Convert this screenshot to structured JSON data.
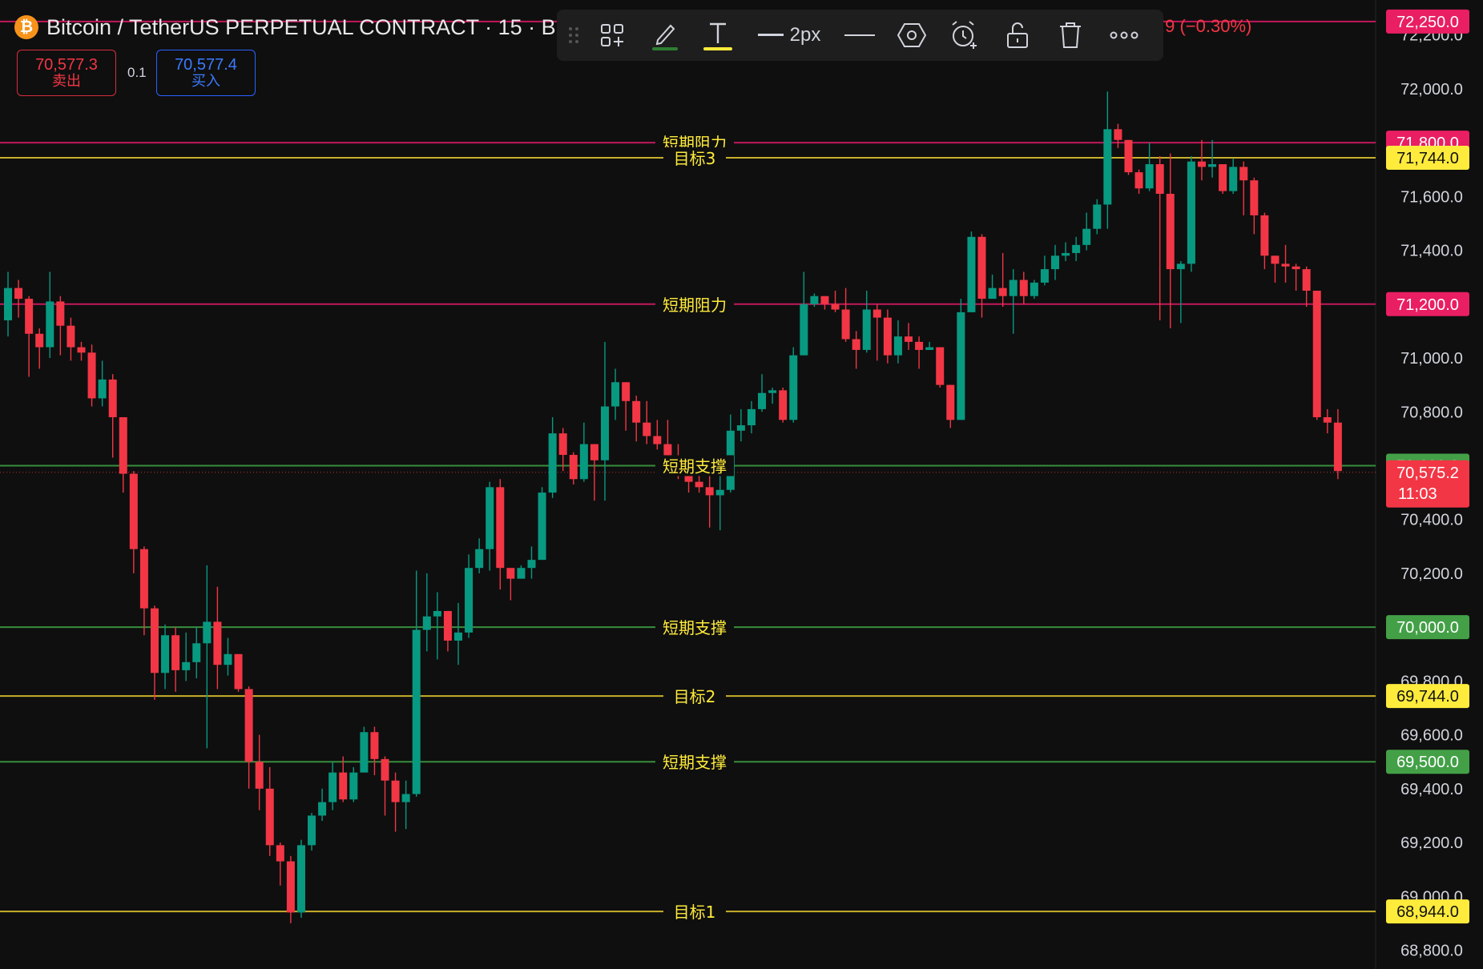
{
  "header": {
    "coin_glyph": "₿",
    "title": "Bitcoin / TetherUS PERPETUAL CONTRACT · 15 · Bin",
    "change_text": ".9 (−0.30%)"
  },
  "trade": {
    "sell_price": "70,577.3",
    "sell_label": "卖出",
    "spread": "0.1",
    "buy_price": "70,577.4",
    "buy_label": "买入"
  },
  "toolbar": {
    "icons": [
      "drag-handle-icon",
      "template-icon",
      "pencil-icon",
      "text-icon",
      "line-width-icon",
      "line-style-icon",
      "hexagon-settings-icon",
      "alert-icon",
      "unlock-icon",
      "trash-icon",
      "more-icon"
    ],
    "line_width_label": "2px",
    "pencil_color": "#2e7d32",
    "text_color": "#ffeb3b"
  },
  "colors": {
    "background": "#0f0f0f",
    "up": "#089981",
    "down": "#f23645",
    "resistance": "#c2185b",
    "support": "#388e3c",
    "target": "#c8b02a",
    "resistance_tag": "#e91e63",
    "support_tag": "#43a047",
    "target_tag": "#ffeb3b",
    "axis_text": "#d1d4dc"
  },
  "chart_data": {
    "type": "candlestick",
    "interval": "15",
    "y_axis_ticks": [
      "72,200.0",
      "72,000.0",
      "71,600.0",
      "71,400.0",
      "71,000.0",
      "70,800.0",
      "70,400.0",
      "70,200.0",
      "69,800.0",
      "69,600.0",
      "69,400.0",
      "69,200.0",
      "69,000.0",
      "68,800.0"
    ],
    "ylim": [
      68730,
      72330
    ],
    "current_price": {
      "value": 70575.2,
      "label": "70,575.2",
      "countdown": "11:03"
    },
    "horizontal_lines": [
      {
        "kind": "resistance",
        "value": 72250,
        "tag": "72,250.0",
        "label": ""
      },
      {
        "kind": "resistance",
        "value": 71800,
        "tag": "71,800.0",
        "label": "短期阻力"
      },
      {
        "kind": "target",
        "value": 71744,
        "tag": "71,744.0",
        "label": "目标3"
      },
      {
        "kind": "resistance",
        "value": 71200,
        "tag": "71,200.0",
        "label": "短期阻力"
      },
      {
        "kind": "support",
        "value": 70600,
        "tag": "70,600.0",
        "label": "短期支撑"
      },
      {
        "kind": "support",
        "value": 70000,
        "tag": "70,000.0",
        "label": "短期支撑"
      },
      {
        "kind": "target",
        "value": 69744,
        "tag": "69,744.0",
        "label": "目标2"
      },
      {
        "kind": "support",
        "value": 69500,
        "tag": "69,500.0",
        "label": "短期支撑"
      },
      {
        "kind": "target",
        "value": 68944,
        "tag": "68,944.0",
        "label": "目标1"
      }
    ],
    "candles": [
      [
        71140,
        71260,
        71320,
        71080
      ],
      [
        71260,
        71220,
        71290,
        71150
      ],
      [
        71220,
        71090,
        71230,
        70930
      ],
      [
        71090,
        71040,
        71110,
        70960
      ],
      [
        71040,
        71210,
        71320,
        71000
      ],
      [
        71210,
        71120,
        71230,
        71010
      ],
      [
        71120,
        71040,
        71150,
        70990
      ],
      [
        71040,
        71020,
        71060,
        70990
      ],
      [
        71020,
        70850,
        71050,
        70820
      ],
      [
        70850,
        70920,
        70990,
        70820
      ],
      [
        70920,
        70780,
        70940,
        70630
      ],
      [
        70780,
        70570,
        70780,
        70500
      ],
      [
        70570,
        70290,
        70580,
        70200
      ],
      [
        70290,
        70070,
        70300,
        69970
      ],
      [
        70070,
        69830,
        70080,
        69730
      ],
      [
        69830,
        69970,
        70010,
        69770
      ],
      [
        69970,
        69840,
        70000,
        69760
      ],
      [
        69840,
        69870,
        69980,
        69800
      ],
      [
        69870,
        69940,
        70000,
        69810
      ],
      [
        69940,
        70020,
        70230,
        69550
      ],
      [
        70020,
        69860,
        70150,
        69770
      ],
      [
        69860,
        69900,
        69960,
        69820
      ],
      [
        69900,
        69770,
        69880,
        69760
      ],
      [
        69770,
        69500,
        69780,
        69400
      ],
      [
        69500,
        69400,
        69600,
        69320
      ],
      [
        69400,
        69190,
        69480,
        69150
      ],
      [
        69190,
        69130,
        69200,
        69040
      ],
      [
        69130,
        68940,
        69150,
        68900
      ],
      [
        68940,
        69190,
        69210,
        68920
      ],
      [
        69190,
        69300,
        69310,
        69170
      ],
      [
        69300,
        69350,
        69400,
        69280
      ],
      [
        69350,
        69460,
        69500,
        69320
      ],
      [
        69460,
        69360,
        69520,
        69350
      ],
      [
        69360,
        69460,
        69480,
        69350
      ],
      [
        69460,
        69610,
        69630,
        69460
      ],
      [
        69610,
        69510,
        69630,
        69450
      ],
      [
        69510,
        69430,
        69520,
        69300
      ],
      [
        69430,
        69350,
        69460,
        69240
      ],
      [
        69350,
        69380,
        69430,
        69250
      ],
      [
        69380,
        69990,
        70210,
        69370
      ],
      [
        69990,
        70040,
        70200,
        69910
      ],
      [
        70040,
        70060,
        70130,
        69880
      ],
      [
        70060,
        69950,
        70030,
        69910
      ],
      [
        69950,
        69980,
        70090,
        69860
      ],
      [
        69980,
        70220,
        70270,
        69960
      ],
      [
        70220,
        70290,
        70330,
        70200
      ],
      [
        70290,
        70520,
        70540,
        70210
      ],
      [
        70520,
        70220,
        70550,
        70140
      ],
      [
        70220,
        70180,
        70180,
        70100
      ],
      [
        70180,
        70220,
        70230,
        70180
      ],
      [
        70220,
        70250,
        70300,
        70180
      ],
      [
        70250,
        70500,
        70520,
        70250
      ],
      [
        70500,
        70720,
        70780,
        70480
      ],
      [
        70720,
        70640,
        70740,
        70580
      ],
      [
        70640,
        70550,
        70650,
        70530
      ],
      [
        70550,
        70680,
        70760,
        70540
      ],
      [
        70680,
        70620,
        70680,
        70470
      ],
      [
        70620,
        70820,
        71060,
        70470
      ],
      [
        70820,
        70910,
        70960,
        70770
      ],
      [
        70910,
        70840,
        70910,
        70730
      ],
      [
        70840,
        70760,
        70860,
        70690
      ],
      [
        70760,
        70710,
        70840,
        70680
      ],
      [
        70710,
        70680,
        70770,
        70660
      ],
      [
        70680,
        70620,
        70770,
        70620
      ],
      [
        70620,
        70580,
        70680,
        70550
      ],
      [
        70580,
        70540,
        70610,
        70500
      ],
      [
        70540,
        70520,
        70580,
        70500
      ],
      [
        70520,
        70490,
        70590,
        70370
      ],
      [
        70490,
        70510,
        70580,
        70360
      ],
      [
        70510,
        70730,
        70790,
        70500
      ],
      [
        70730,
        70750,
        70810,
        70690
      ],
      [
        70750,
        70810,
        70840,
        70720
      ],
      [
        70810,
        70870,
        70940,
        70800
      ],
      [
        70870,
        70880,
        70890,
        70830
      ],
      [
        70880,
        70770,
        70890,
        70760
      ],
      [
        70770,
        71010,
        71040,
        70760
      ],
      [
        71010,
        71200,
        71320,
        71010
      ],
      [
        71200,
        71230,
        71240,
        71190
      ],
      [
        71230,
        71200,
        71220,
        71180
      ],
      [
        71200,
        71180,
        71250,
        71170
      ],
      [
        71180,
        71070,
        71260,
        71060
      ],
      [
        71070,
        71030,
        71100,
        70960
      ],
      [
        71030,
        71180,
        71250,
        71020
      ],
      [
        71180,
        71150,
        71200,
        70990
      ],
      [
        71150,
        71010,
        71180,
        70980
      ],
      [
        71010,
        71080,
        71140,
        70980
      ],
      [
        71080,
        71060,
        71130,
        71030
      ],
      [
        71060,
        71030,
        71080,
        70960
      ],
      [
        71030,
        71040,
        71060,
        71030
      ],
      [
        71040,
        70900,
        71040,
        70890
      ],
      [
        70900,
        70770,
        70900,
        70740
      ],
      [
        70770,
        71170,
        71220,
        70770
      ],
      [
        71170,
        71450,
        71470,
        71170
      ],
      [
        71450,
        71220,
        71460,
        71150
      ],
      [
        71220,
        71260,
        71310,
        71220
      ],
      [
        71260,
        71230,
        71390,
        71190
      ],
      [
        71230,
        71290,
        71330,
        71090
      ],
      [
        71290,
        71230,
        71320,
        71200
      ],
      [
        71230,
        71280,
        71290,
        71220
      ],
      [
        71280,
        71330,
        71380,
        71270
      ],
      [
        71330,
        71380,
        71420,
        71290
      ],
      [
        71380,
        71390,
        71430,
        71360
      ],
      [
        71390,
        71420,
        71450,
        71360
      ],
      [
        71420,
        71480,
        71540,
        71400
      ],
      [
        71480,
        71570,
        71590,
        71460
      ],
      [
        71570,
        71850,
        71990,
        71480
      ],
      [
        71850,
        71810,
        71870,
        71780
      ],
      [
        71810,
        71690,
        71800,
        71680
      ],
      [
        71690,
        71630,
        71700,
        71610
      ],
      [
        71630,
        71720,
        71800,
        71620
      ],
      [
        71720,
        71610,
        71750,
        71140
      ],
      [
        71610,
        71330,
        71760,
        71110
      ],
      [
        71330,
        71350,
        71360,
        71130
      ],
      [
        71350,
        71730,
        71750,
        71320
      ],
      [
        71730,
        71710,
        71810,
        71660
      ],
      [
        71710,
        71720,
        71810,
        71670
      ],
      [
        71720,
        71620,
        71710,
        71610
      ],
      [
        71620,
        71710,
        71740,
        71610
      ],
      [
        71710,
        71660,
        71730,
        71530
      ],
      [
        71660,
        71530,
        71670,
        71460
      ],
      [
        71530,
        71380,
        71540,
        71330
      ],
      [
        71380,
        71350,
        71380,
        71280
      ],
      [
        71350,
        71340,
        71420,
        71280
      ],
      [
        71340,
        71330,
        71350,
        71250
      ],
      [
        71330,
        71250,
        71340,
        71190
      ],
      [
        71250,
        70780,
        71210,
        70770
      ],
      [
        70780,
        70760,
        70810,
        70720
      ],
      [
        70760,
        70580,
        70810,
        70550
      ]
    ]
  }
}
